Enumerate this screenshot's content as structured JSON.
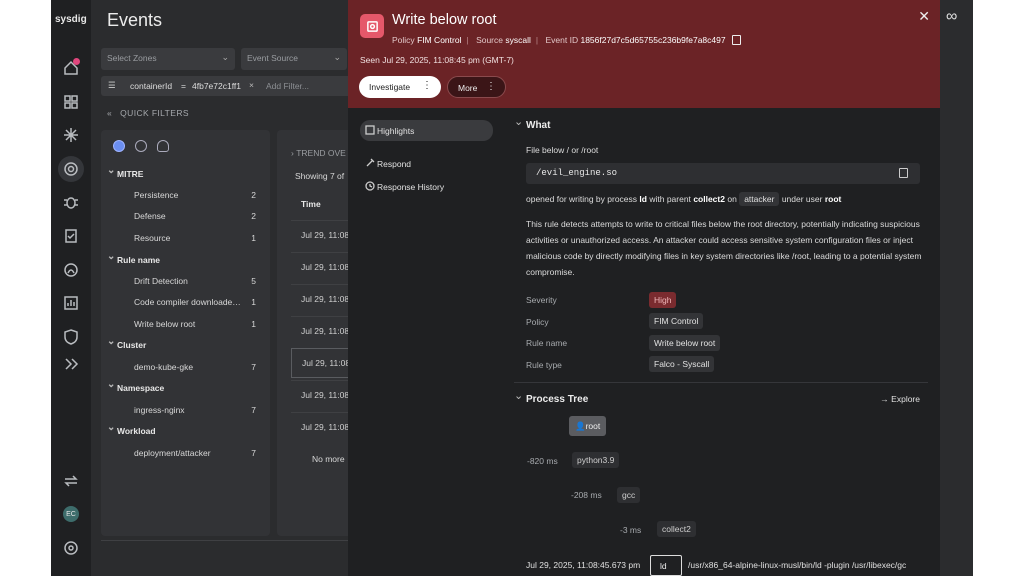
{
  "app": {
    "logo": "sysdig",
    "page_title": "Events"
  },
  "filters": {
    "zones_placeholder": "Select Zones",
    "source_placeholder": "Event Source",
    "token_key": "containerId",
    "token_op": "=",
    "token_value": "4fb7e72c1ff1",
    "add_filter_placeholder": "Add Filter..."
  },
  "quick_filters": {
    "title": "QUICK FILTERS",
    "groups": [
      {
        "name": "MITRE",
        "items": [
          {
            "label": "Persistence",
            "count": "2"
          },
          {
            "label": "Defense",
            "count": "2"
          },
          {
            "label": "Resource",
            "count": "1"
          }
        ]
      },
      {
        "name": "Rule name",
        "items": [
          {
            "label": "Drift Detection",
            "count": "5"
          },
          {
            "label": "Code compiler downloaded...",
            "count": "1"
          },
          {
            "label": "Write below root",
            "count": "1"
          }
        ]
      },
      {
        "name": "Cluster",
        "items": [
          {
            "label": "demo-kube-gke",
            "count": "7"
          }
        ]
      },
      {
        "name": "Namespace",
        "items": [
          {
            "label": "ingress-nginx",
            "count": "7"
          }
        ]
      },
      {
        "name": "Workload",
        "items": [
          {
            "label": "deployment/attacker",
            "count": "7"
          }
        ]
      }
    ]
  },
  "events_list": {
    "trend": "TREND OVE",
    "showing": "Showing 7 of",
    "time_header": "Time",
    "rows": [
      "Jul 29, 11:08",
      "Jul 29, 11:08",
      "Jul 29, 11:08",
      "Jul 29, 11:08",
      "Jul 29, 11:08",
      "Jul 29, 11:08",
      "Jul 29, 11:08"
    ],
    "no_more": "No more"
  },
  "drawer": {
    "title": "Write below root",
    "policy_label": "Policy",
    "policy_value": "FIM Control",
    "source_label": "Source",
    "source_value": "syscall",
    "event_id_label": "Event ID",
    "event_id_value": "1856f27d7c5d65755c236b9fe7a8c497",
    "seen": "Seen Jul 29, 2025, 11:08:45 pm (GMT-7)",
    "investigate_label": "Investigate",
    "more_label": "More",
    "nav": [
      "Highlights",
      "Respond",
      "Response History"
    ],
    "what": {
      "title": "What",
      "file_text": "File below / or /root",
      "code": "/evil_engine.so",
      "opened_prefix": "opened for writing by process",
      "process": "ld",
      "parent_text": "with parent",
      "parent": "collect2",
      "on_text": "on",
      "host": "attacker",
      "user_text": "under user",
      "user": "root",
      "description": "This rule detects attempts to write to critical files below the root directory, potentially indicating suspicious activities or unauthorized access. An attacker could access sensitive system configuration files or inject malicious code by directly modifying files in key system directories like /root, leading to a potential system compromise.",
      "details": [
        {
          "key": "Severity",
          "value": "High"
        },
        {
          "key": "Policy",
          "value": "FIM Control"
        },
        {
          "key": "Rule name",
          "value": "Write below root"
        },
        {
          "key": "Rule type",
          "value": "Falco - Syscall"
        }
      ]
    },
    "process_tree": {
      "title": "Process Tree",
      "explore_label": "Explore",
      "nodes": [
        {
          "time": "",
          "name": "root"
        },
        {
          "time": "-820 ms",
          "name": "python3.9"
        },
        {
          "time": "-208 ms",
          "name": "gcc"
        },
        {
          "time": "-3 ms",
          "name": "collect2"
        }
      ],
      "last_time": "Jul 29, 2025, 11:08:45.673 pm",
      "last_name": "ld",
      "last_cmd": "/usr/x86_64-alpine-linux-musl/bin/ld -plugin /usr/libexec/gc"
    }
  },
  "colors": {
    "header_red": "#6b2326",
    "severity_high": "#7a2b2f",
    "accent": "#e5586a"
  }
}
